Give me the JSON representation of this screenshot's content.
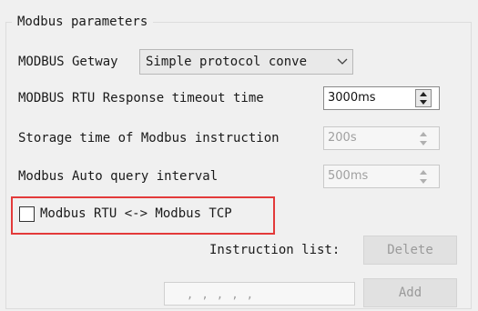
{
  "group": {
    "title": "Modbus parameters"
  },
  "gateway": {
    "label": "MODBUS Getway",
    "value": "Simple protocol conve"
  },
  "rtu_timeout": {
    "label": "MODBUS RTU Response timeout time",
    "value": "3000ms"
  },
  "storage_time": {
    "label": "Storage time of Modbus instruction",
    "value": "200s"
  },
  "auto_query": {
    "label": "Modbus Auto query interval",
    "value": "500ms"
  },
  "bridge_checkbox": {
    "label": "Modbus RTU <-> Modbus TCP",
    "checked": false
  },
  "instruction_list": {
    "label": "Instruction list:",
    "value": ", , , , ,"
  },
  "buttons": {
    "delete_label": "Delete",
    "add_label": "Add"
  },
  "colors": {
    "highlight_border": "#e33a3a",
    "background": "#f0f0f0",
    "disabled_text": "#a0a0a0"
  },
  "icons": {
    "combo_arrow": "chevron-down-icon",
    "spin_up": "triangle-up-icon",
    "spin_down": "triangle-down-icon"
  }
}
